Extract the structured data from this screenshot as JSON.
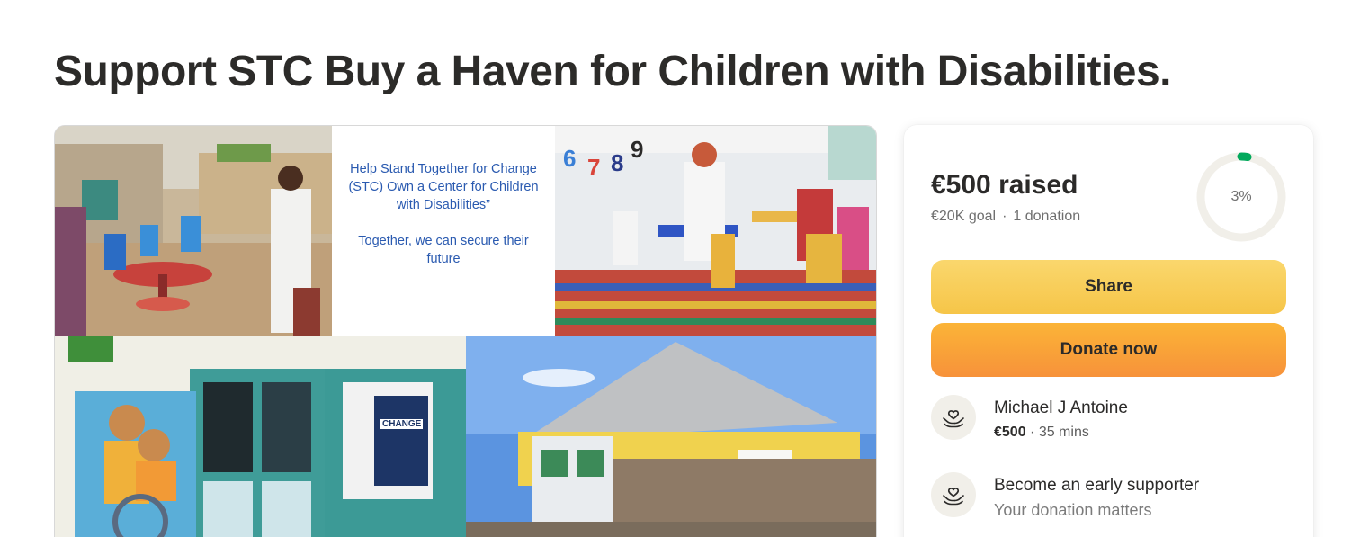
{
  "page": {
    "title": "Support STC Buy a Haven for Children with Disabilities."
  },
  "gallery": {
    "caption_lines": [
      "Help Stand Together for Change",
      "(STC) Own a Center for Children",
      "with Disabilities”",
      "Together, we can secure their",
      "future"
    ],
    "signage": [
      "CHANGE"
    ]
  },
  "fundraiser": {
    "raised_label": "€500 raised",
    "goal_label": "€20K goal",
    "separator": "·",
    "donations_label": "1 donation",
    "progress_label": "3%",
    "progress_fraction": 0.025,
    "share_label": "Share",
    "donate_label": "Donate now",
    "accent_color": "#02a95c"
  },
  "supporters": [
    {
      "name": "Michael J Antoine",
      "amount": "€500",
      "time": " · 35 mins",
      "icon": "heart-hands-icon"
    },
    {
      "name": "Become an early supporter",
      "subtitle": "Your donation matters",
      "icon": "heart-hands-icon"
    }
  ]
}
